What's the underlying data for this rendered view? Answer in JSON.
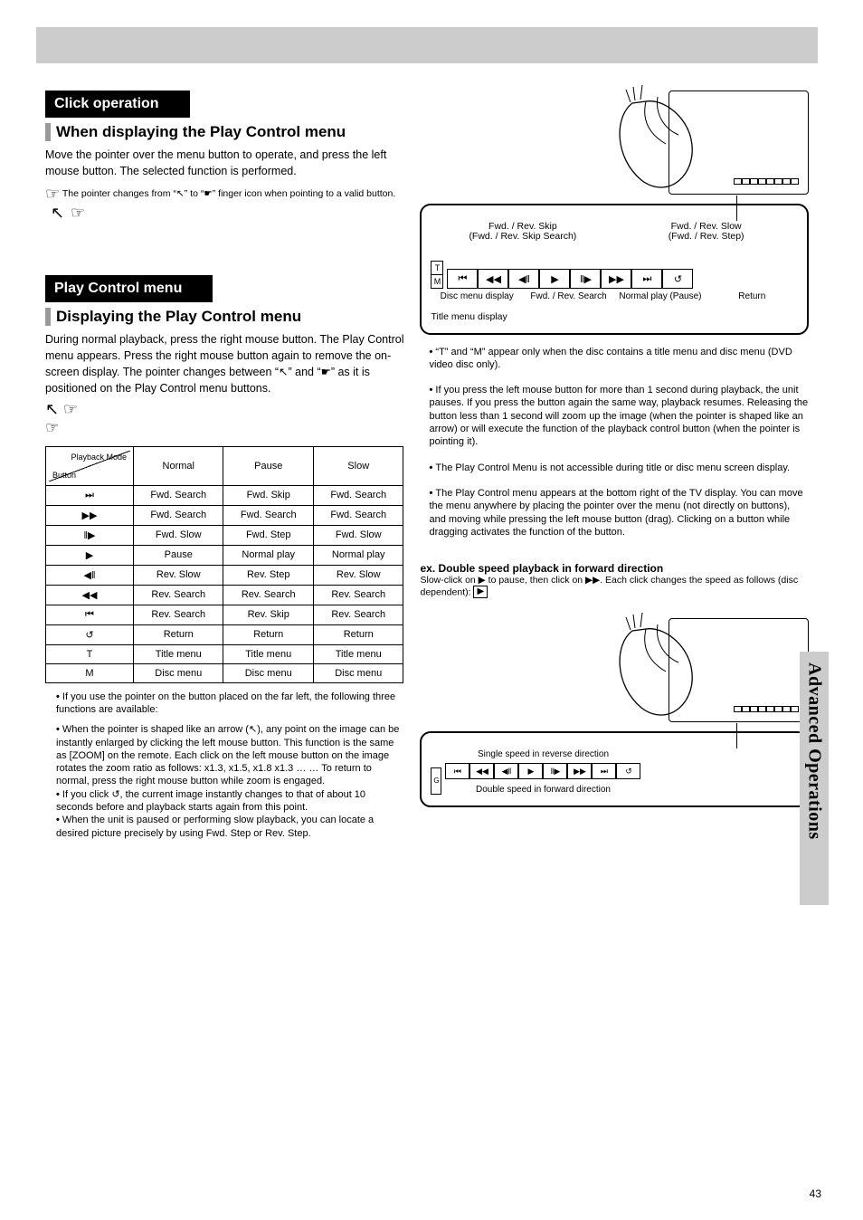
{
  "headings": {
    "section1": "Click operation",
    "sub1": "When displaying the Play Control menu",
    "sub1_para": "Move the pointer over the menu button to operate, and press the left mouse button. The selected function is performed.",
    "sub1_note": "The pointer changes from “↖” to “☛” finger icon when pointing to a valid button.",
    "section2": "Play Control menu",
    "sub2": "Displaying the Play Control menu",
    "sub2_para": "During normal playback, press the right mouse button. The Play Control menu appears. Press the right mouse button again to remove the on-screen display. The pointer changes between “↖” and “☛” as it is positioned on the Play Control menu buttons."
  },
  "table": {
    "columns": [
      "Normal",
      "Pause",
      "Slow"
    ],
    "rows": [
      {
        "btn": "⏭",
        "c": [
          "Fwd. Search",
          "Fwd. Skip",
          "Fwd. Search"
        ]
      },
      {
        "btn": "▶▶",
        "c": [
          "Fwd. Search",
          "Fwd. Search",
          "Fwd. Search"
        ]
      },
      {
        "btn": "‖▶",
        "c": [
          "Fwd. Slow",
          "Fwd. Step",
          "Fwd. Slow"
        ]
      },
      {
        "btn": "▶",
        "c": [
          "Pause",
          "Normal play",
          "Normal play"
        ]
      },
      {
        "btn": "◀‖",
        "c": [
          "Rev. Slow",
          "Rev. Step",
          "Rev. Slow"
        ]
      },
      {
        "btn": "◀◀",
        "c": [
          "Rev. Search",
          "Rev. Search",
          "Rev. Search"
        ]
      },
      {
        "btn": "⏮",
        "c": [
          "Rev. Search",
          "Rev. Skip",
          "Rev. Search"
        ]
      },
      {
        "btn": "↺",
        "c": [
          "Return",
          "Return",
          "Return"
        ]
      },
      {
        "btn": "T",
        "c": [
          "Title menu",
          "Title menu",
          "Title menu"
        ]
      },
      {
        "btn": "M",
        "c": [
          "Disc menu",
          "Disc menu",
          "Disc menu"
        ]
      }
    ],
    "diag_upper": "Playback Mode",
    "diag_lower": "Button"
  },
  "note_below_table": "If you use the pointer on the button placed on the far left, the following three functions are available:",
  "bullets": [
    "When the pointer is shaped like an arrow (↖), any point on the image can be instantly enlarged by clicking the left mouse button. This function is the same as [ZOOM] on the remote. Each click on the left mouse button on the image rotates the zoom ratio as follows: x1.3, x1.5, x1.8 x1.3 … … To return to normal, press the right mouse button while zoom is engaged.",
    "If you click ↺, the current image instantly changes to that of about 10 seconds before and playback starts again from this point.",
    "When the unit is paused or performing slow playback, you can locate a desired picture precisely by using Fwd. Step or Rev. Step."
  ],
  "right_col": {
    "intro_bullets": [
      "“T” and “M” appear only when the disc contains a title menu and disc menu (DVD video disc only).",
      "If you press the left mouse button for more than 1 second during playback, the unit pauses. If you press the button again the same way, playback resumes. Releasing the button less than 1 second will zoom up the image (when the pointer is shaped like an arrow) or will execute the function of the playback control button (when the pointer is pointing it).",
      "The Play Control Menu is not accessible during title or disc menu screen display.",
      "The Play Control menu appears at the bottom right of the TV display. You can move the menu anywhere by placing the pointer over the menu (not directly on buttons), and moving while pressing the left mouse button (drag). Clicking on a button while dragging activates the function of the button."
    ],
    "ex_heading": "ex. Double speed playback in forward direction",
    "ex_text": "Slow-click on ▶ to pause, then click on ▶▶. Each click changes the speed as follows (disc dependent):"
  },
  "menu_panel1": {
    "top_labels_left": "Fwd. / Rev. Skip\n(Fwd. / Rev. Skip Search)",
    "top_labels_right": "Fwd. / Rev. Slow\n(Fwd. / Rev. Step)",
    "cap_bottom": [
      "Disc menu display",
      "Fwd. / Rev. Search",
      "Normal play (Pause)",
      "Return"
    ],
    "left_label": "Title menu display",
    "buttons": [
      "⏮",
      "◀◀",
      "◀‖",
      "▶",
      "‖▶",
      "▶▶",
      "⏭",
      "↺"
    ]
  },
  "menu_panel2": {
    "caption_top": "Single speed in reverse direction",
    "caption_bottom": "Double speed in forward direction",
    "label_g": "G",
    "buttons": [
      "⏮",
      "◀◀",
      "◀‖",
      "▶",
      "‖▶",
      "▶▶",
      "⏭",
      "↺"
    ]
  },
  "side_tab": "Advanced Operations",
  "page_number": "43"
}
